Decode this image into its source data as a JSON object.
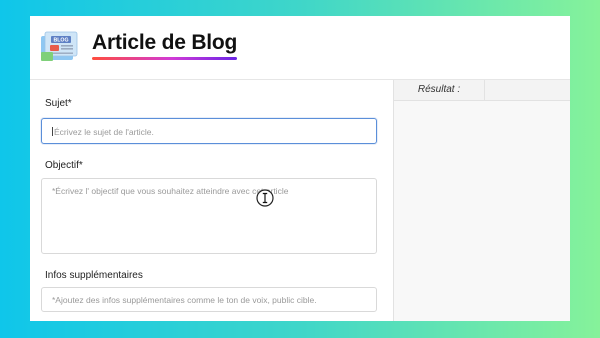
{
  "app": {
    "title": "Article de Blog",
    "logo_text": "BLOG"
  },
  "form": {
    "subject": {
      "label": "Sujet*",
      "placeholder": "Écrivez le sujet de l'article."
    },
    "objective": {
      "label": "Objectif*",
      "placeholder": "*Écrivez l' objectif que vous souhaitez atteindre avec cet article"
    },
    "extra": {
      "label": "Infos supplémentaires",
      "placeholder": "*Ajoutez des infos supplémentaires comme le ton de voix, public cible."
    }
  },
  "result": {
    "tab_label": "Résultat :"
  },
  "colors": {
    "accent_blue": "#5b8fd9",
    "title_gradient": [
      "#ff4d3d",
      "#d13ad6",
      "#6a25e6"
    ]
  },
  "icons": {
    "cursor": "text-cursor-icon",
    "logo": "blog-logo-icon"
  }
}
